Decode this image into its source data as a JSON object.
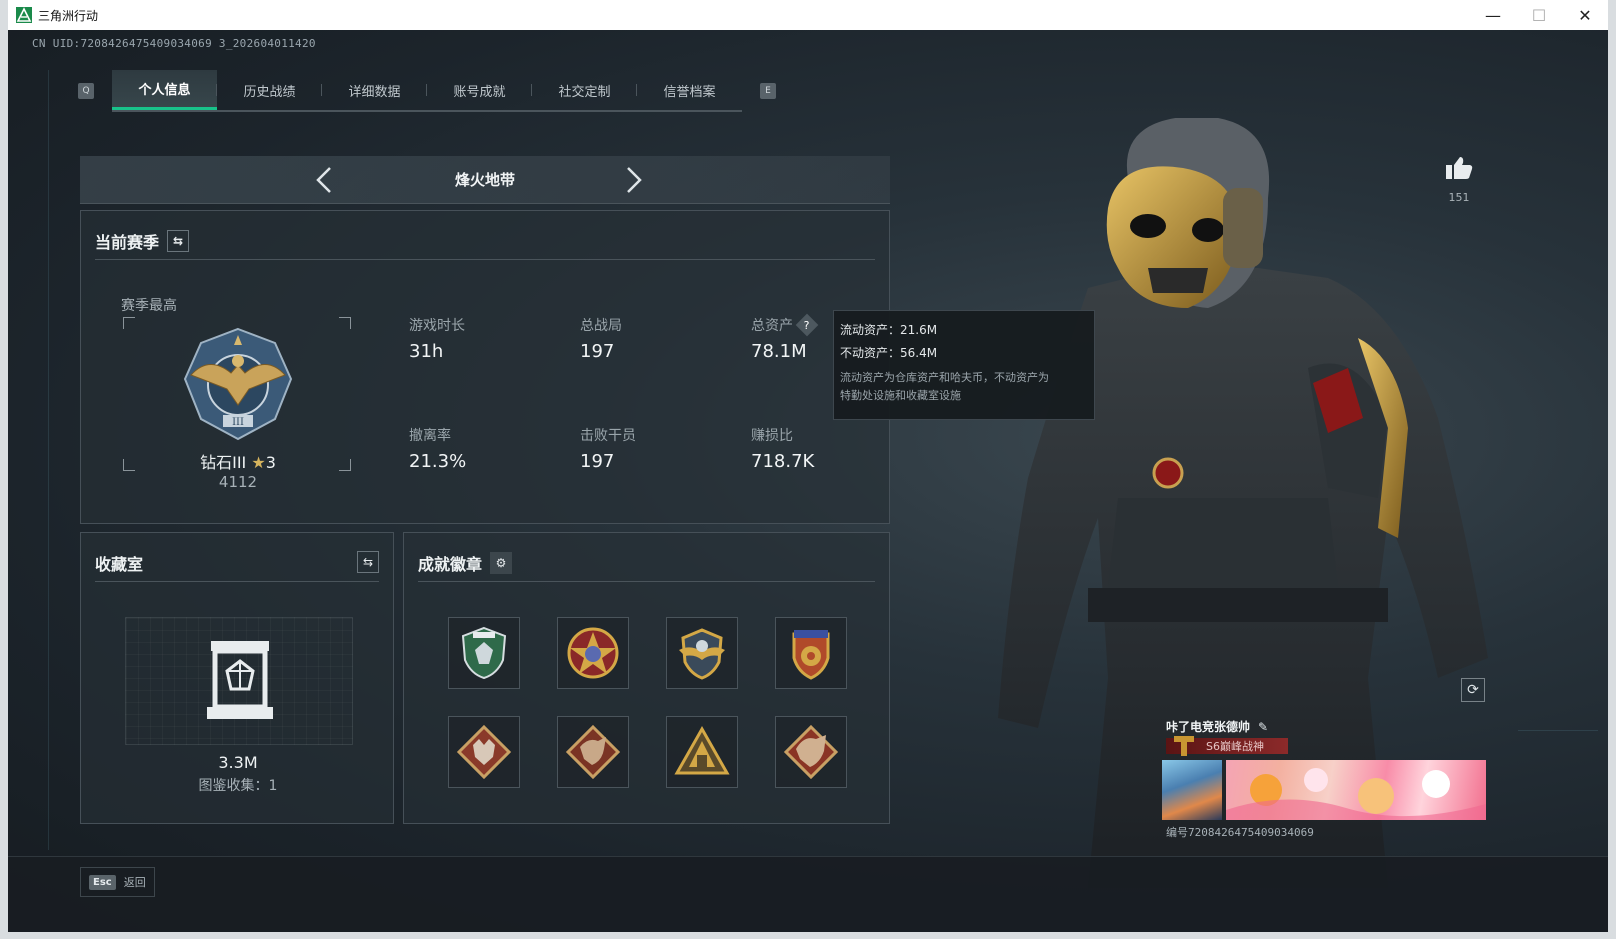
{
  "window": {
    "title": "三角洲行动",
    "controls": {
      "minimize": "—",
      "maximize": "☐",
      "close": "✕"
    }
  },
  "uid_text": "CN UID:7208426475409034069 3_202604011420",
  "tabs": {
    "left_key": "Q",
    "right_key": "E",
    "items": [
      "个人信息",
      "历史战绩",
      "详细数据",
      "账号成就",
      "社交定制",
      "信誉档案"
    ],
    "active_index": 0
  },
  "mode_bar": {
    "title": "烽火地带",
    "prev_icon": "chevron-left-icon",
    "next_icon": "chevron-right-icon"
  },
  "season": {
    "title": "当前赛季",
    "best_label": "赛季最高",
    "rank_name": "钻石III",
    "rank_stars": "3",
    "rank_score": "4112",
    "stats": {
      "play_time": {
        "label": "游戏时长",
        "value": "31h"
      },
      "total_matches": {
        "label": "总战局",
        "value": "197"
      },
      "total_assets": {
        "label": "总资产",
        "value": "78.1M"
      },
      "extract_rate": {
        "label": "撤离率",
        "value": "21.3%"
      },
      "kills": {
        "label": "击败干员",
        "value": "197"
      },
      "profit_ratio": {
        "label": "赚损比",
        "value": "718.7K"
      }
    }
  },
  "tooltip": {
    "liquid": "流动资产：21.6M",
    "fixed": "不动资产：56.4M",
    "note_line1": "流动资产为仓库资产和哈夫币，不动资产为",
    "note_line2": "特勤处设施和收藏室设施"
  },
  "vault": {
    "title": "收藏室",
    "value": "3.3M",
    "collection": "图鉴收集：1"
  },
  "badges": {
    "title": "成就徽章",
    "items": [
      "shield-badge",
      "star-badge",
      "wings-badge",
      "crest-badge",
      "wolf-badge",
      "dragon-badge",
      "peak-badge",
      "dragon-badge-2"
    ]
  },
  "likes": {
    "count": "151"
  },
  "card": {
    "name": "咔了电竞张德帅",
    "title": "S6巅峰战神",
    "id": "编号7208426475409034069"
  },
  "bottom": {
    "esc_key": "Esc",
    "back_label": "返回"
  },
  "colors": {
    "accent": "#18c28a",
    "gold": "#c89632",
    "panel": "#262f36"
  }
}
